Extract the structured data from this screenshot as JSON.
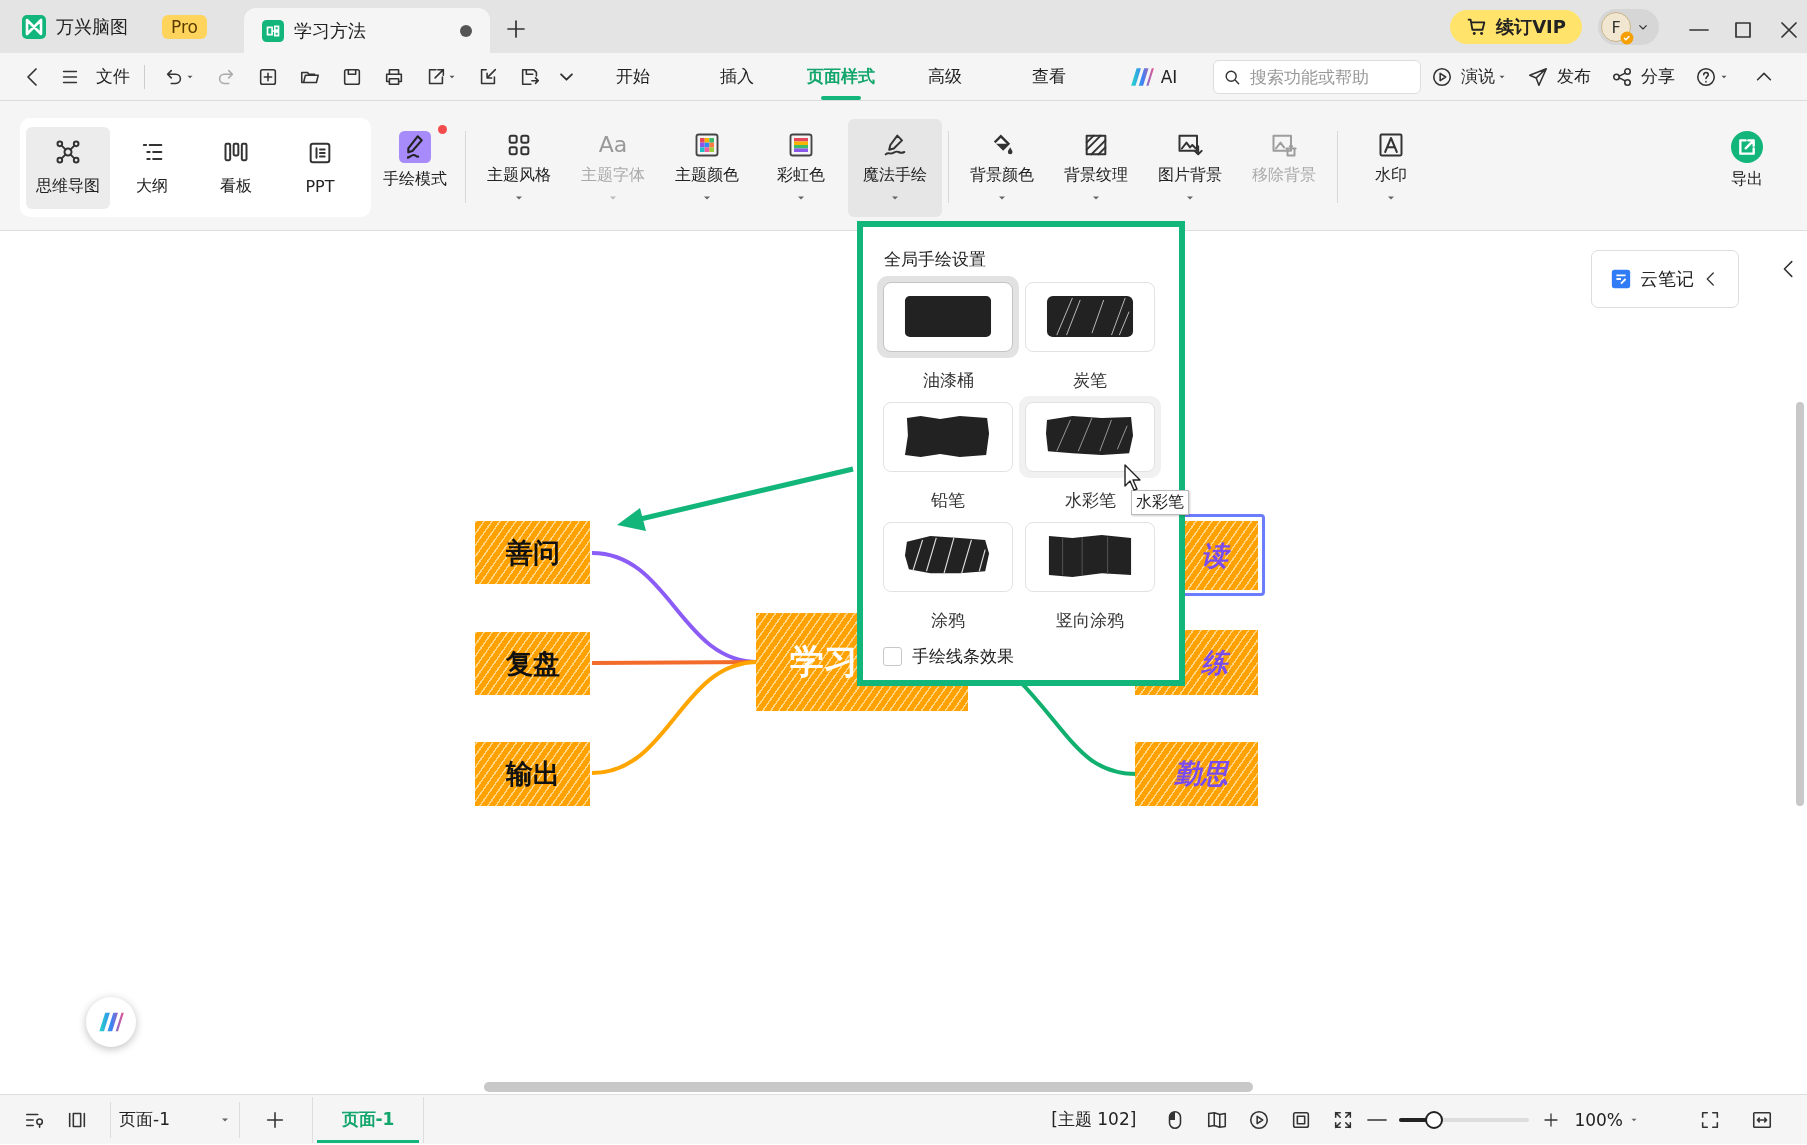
{
  "app_tab": {
    "label": "万兴脑图",
    "badge": "Pro"
  },
  "doc_tabs": [
    {
      "label": "学习方法",
      "selected": true,
      "unsaved": true
    }
  ],
  "vip_button": "续订VIP",
  "avatar": "F",
  "menu": {
    "file": "文件",
    "tabs": [
      {
        "label": "开始",
        "kind": "text",
        "selected": false
      },
      {
        "label": "插入",
        "kind": "text",
        "selected": false
      },
      {
        "label": "页面样式",
        "kind": "text",
        "selected": true
      },
      {
        "label": "高级",
        "kind": "text",
        "selected": false
      },
      {
        "label": "查看",
        "kind": "text",
        "selected": false
      },
      {
        "label": "AI",
        "kind": "ai",
        "selected": false
      }
    ],
    "search": {
      "placeholder": "搜索功能或帮助"
    },
    "actions": [
      {
        "label": "演说",
        "dropdown": true
      },
      {
        "label": "发布",
        "dropdown": false
      },
      {
        "label": "分享",
        "dropdown": false
      }
    ]
  },
  "ribbon": {
    "views": [
      {
        "label": "思维导图",
        "selected": true
      },
      {
        "label": "大纲",
        "selected": false
      },
      {
        "label": "看板",
        "selected": false
      },
      {
        "label": "PPT",
        "selected": false
      }
    ],
    "hand_drawn_mode": {
      "label": "手绘模式",
      "on": true,
      "notification": true
    },
    "groups": [
      [
        {
          "label": "主题风格",
          "dropdown": true,
          "disabled": false,
          "open": false
        },
        {
          "label": "主题字体",
          "icon_text": "Aa",
          "dropdown": true,
          "disabled": true,
          "open": false
        },
        {
          "label": "主题颜色",
          "dropdown": true,
          "disabled": false,
          "open": false
        },
        {
          "label": "彩虹色",
          "dropdown": true,
          "disabled": false,
          "open": false
        },
        {
          "label": "魔法手绘",
          "dropdown": true,
          "disabled": false,
          "open": true
        }
      ],
      [
        {
          "label": "背景颜色",
          "dropdown": true,
          "disabled": false,
          "open": false
        },
        {
          "label": "背景纹理",
          "dropdown": true,
          "disabled": false,
          "open": false
        },
        {
          "label": "图片背景",
          "dropdown": true,
          "disabled": false,
          "open": false
        },
        {
          "label": "移除背景",
          "dropdown": false,
          "disabled": true,
          "open": false
        }
      ],
      [
        {
          "label": "水印",
          "dropdown": true,
          "disabled": false,
          "open": false
        }
      ]
    ],
    "export": "导出"
  },
  "popup": {
    "title": "全局手绘设置",
    "options": [
      {
        "label": "油漆桶",
        "selected": true,
        "hovered": false
      },
      {
        "label": "炭笔",
        "selected": false,
        "hovered": false
      },
      {
        "label": "铅笔",
        "selected": false,
        "hovered": false
      },
      {
        "label": "水彩笔",
        "selected": false,
        "hovered": true
      },
      {
        "label": "涂鸦",
        "selected": false,
        "hovered": false
      },
      {
        "label": "竖向涂鸦",
        "selected": false,
        "hovered": false
      }
    ],
    "tooltip": "水彩笔",
    "checkbox": {
      "label": "手绘线条效果",
      "checked": false
    }
  },
  "mind_map": {
    "central": {
      "label": "学习"
    },
    "left": [
      {
        "label": "善问",
        "color": "#8b5cf6"
      },
      {
        "label": "复盘",
        "color": "#f26b2a"
      },
      {
        "label": "输出",
        "color": "#ffa500"
      }
    ],
    "right": [
      {
        "label": "读",
        "selected": true
      },
      {
        "label": "练",
        "selected": false
      },
      {
        "label": "勤思",
        "selected": false,
        "color": "#12b06e"
      }
    ]
  },
  "cloud_note": "云笔记",
  "status_bar": {
    "page_select": "页面-1",
    "pages": [
      {
        "label": "页面-1",
        "selected": true
      }
    ],
    "topic_count": "[主题 102]",
    "zoom": {
      "level": 0.27,
      "reading": "100%"
    }
  }
}
